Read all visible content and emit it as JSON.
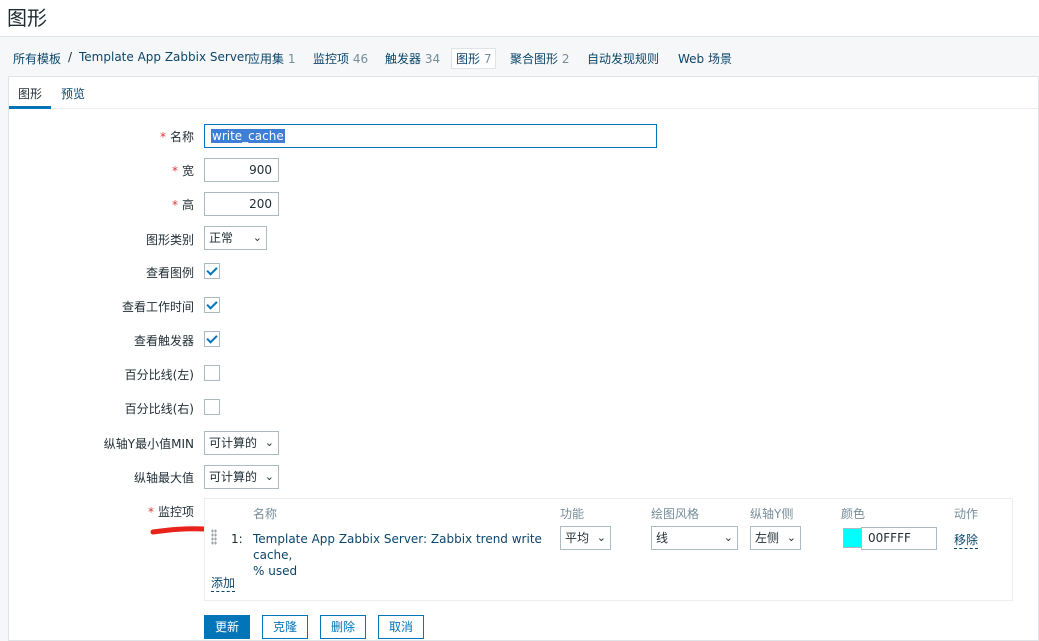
{
  "page": {
    "title": "图形"
  },
  "breadcrumbs": {
    "all_templates": "所有模板",
    "separator": "/",
    "template": "Template App Zabbix Server",
    "apps": "应用集",
    "apps_count": "1",
    "items": "监控项",
    "items_count": "46",
    "triggers": "触发器",
    "triggers_count": "34",
    "graphs": "图形",
    "graphs_count": "7",
    "screens": "聚合图形",
    "screens_count": "2",
    "discovery": "自动发现规则",
    "web": "Web 场景"
  },
  "tabs": {
    "graph": "图形",
    "preview": "预览"
  },
  "form": {
    "name_label": "名称",
    "name_value": "write_cache",
    "width_label": "宽",
    "width_value": "900",
    "height_label": "高",
    "height_value": "200",
    "type_label": "图形类别",
    "type_value": "正常",
    "show_legend_label": "查看图例",
    "show_legend": true,
    "show_worktime_label": "查看工作时间",
    "show_worktime": true,
    "show_triggers_label": "查看触发器",
    "show_triggers": true,
    "percentile_left_label": "百分比线(左)",
    "percentile_left": false,
    "percentile_right_label": "百分比线(右)",
    "percentile_right": false,
    "ymin_label": "纵轴Y最小值MIN",
    "ymin_value": "可计算的",
    "ymax_label": "纵轴最大值",
    "ymax_value": "可计算的",
    "items_label": "监控项",
    "required_mark": "*"
  },
  "items_table": {
    "headers": {
      "name": "名称",
      "function": "功能",
      "style": "绘图风格",
      "y_side": "纵轴Y侧",
      "color": "颜色",
      "action": "动作"
    },
    "rows": [
      {
        "index": "1:",
        "name_line1": "Template App Zabbix Server: Zabbix trend write cache,",
        "name_line2": "% used",
        "function": "平均",
        "style": "线",
        "y_side": "左侧",
        "color": "00FFFF",
        "action": "移除"
      }
    ],
    "add_label": "添加"
  },
  "buttons": {
    "update": "更新",
    "clone": "克隆",
    "delete": "删除",
    "cancel": "取消"
  },
  "icons": {
    "checkbox_checked": "check-icon",
    "dropdown": "chevron-down-icon",
    "drag": "drag-handle-icon"
  },
  "colors": {
    "link": "#0a466a",
    "accent": "#0275b8",
    "required": "#e33734",
    "swatch": "#00ffff"
  }
}
